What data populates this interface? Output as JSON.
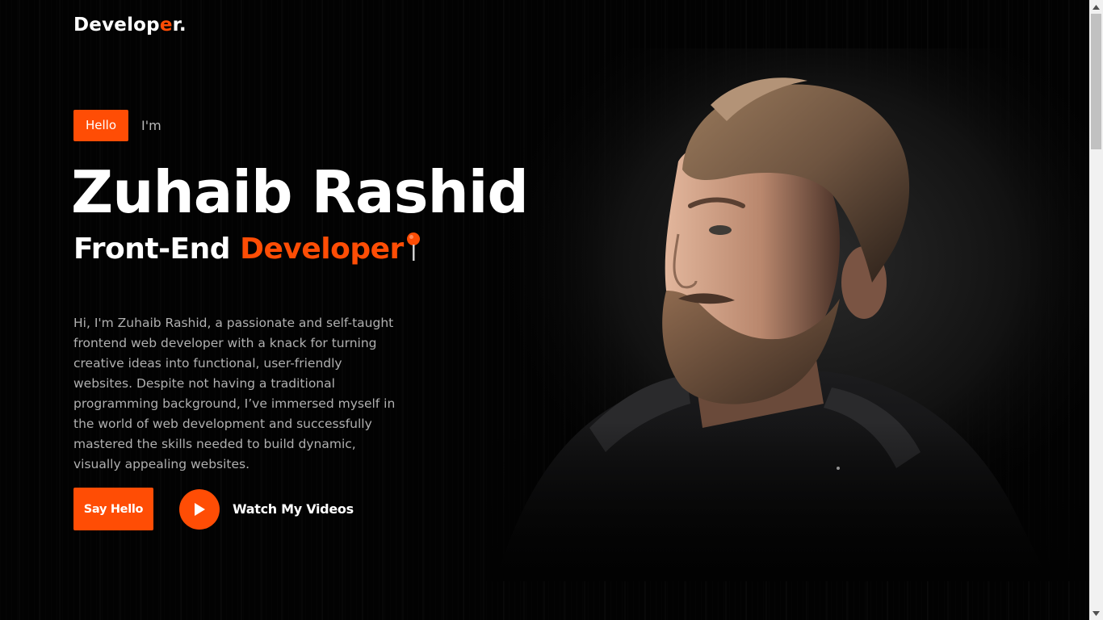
{
  "header": {
    "logo_main": "Develop",
    "logo_accent": "e",
    "logo_tail": "r."
  },
  "hero": {
    "hello_badge": "Hello",
    "im_label": "I'm",
    "name": "Zuhaib Rashid",
    "role_prefix": "Front-End ",
    "role_accent": "Developer",
    "role_icon": "pushpin-icon",
    "bio": "Hi, I'm Zuhaib Rashid, a passionate and self-taught frontend web developer with a knack for turning creative ideas into functional, user-friendly websites. Despite not having a traditional programming background, I’ve immersed myself in the world of web development and successfully mastered the skills needed to build dynamic, visually appealing websites."
  },
  "actions": {
    "say_hello": "Say Hello",
    "watch_videos": "Watch My Videos",
    "play_icon": "play-icon"
  },
  "colors": {
    "accent": "#ff4d05",
    "background": "#020202",
    "text": "#ffffff",
    "muted_text": "#b0b0b0"
  }
}
